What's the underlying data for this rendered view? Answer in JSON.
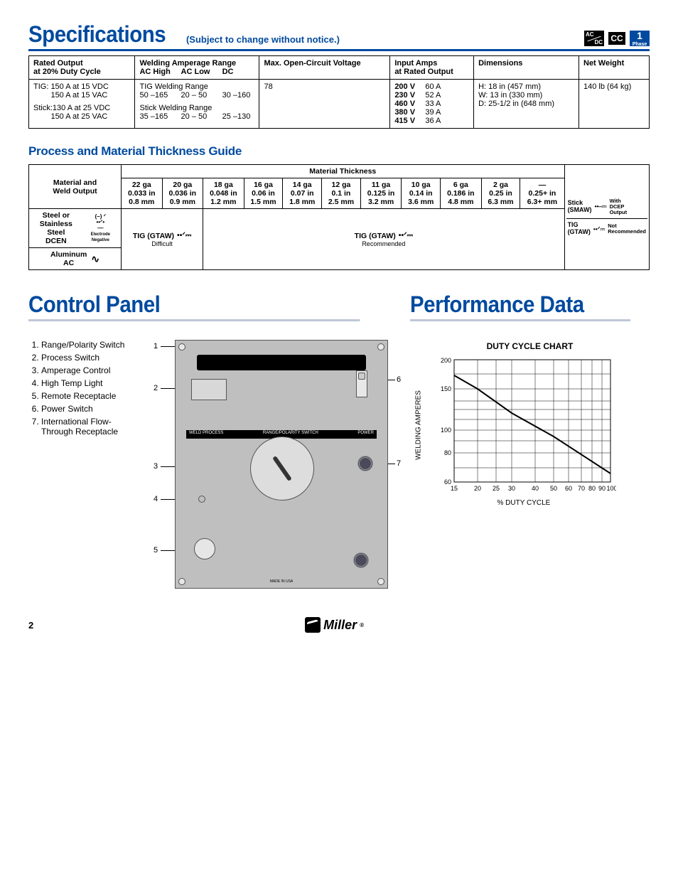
{
  "header": {
    "title": "Specifications",
    "subtitle": "(Subject to change without notice.)",
    "badges": {
      "acdc": "AC/DC",
      "cc": "CC",
      "phase_num": "1",
      "phase_word": "Phase"
    }
  },
  "specs": {
    "cols": {
      "rated_output": "Rated Output\nat 20% Duty Cycle",
      "welding_range": "Welding Amperage Range",
      "welding_sub": {
        "ac_high": "AC High",
        "ac_low": "AC Low",
        "dc": "DC"
      },
      "max_ocv": "Max. Open-Circuit Voltage",
      "input_amps": "Input Amps\nat Rated Output",
      "dimensions": "Dimensions",
      "net_weight": "Net Weight"
    },
    "rated_output": {
      "tig": "TIG: 150 A at 15 VDC\n        150 A at 15 VAC",
      "stick": "Stick:130 A at 25 VDC\n        150 A at 25 VAC"
    },
    "welding": {
      "tig_label": "TIG Welding Range",
      "tig_vals": {
        "ac_high": "50 –165",
        "ac_low": "20 – 50",
        "dc": "30 –160"
      },
      "stick_label": "Stick Welding Range",
      "stick_vals": {
        "ac_high": "35 –165",
        "ac_low": "20 – 50",
        "dc": "25 –130"
      }
    },
    "max_ocv": "78",
    "input_amps": [
      {
        "v": "200 V",
        "a": "60 A"
      },
      {
        "v": "230 V",
        "a": "52 A"
      },
      {
        "v": "460 V",
        "a": "33 A"
      },
      {
        "v": "380 V",
        "a": "39 A"
      },
      {
        "v": "415 V",
        "a": "36 A"
      }
    ],
    "dimensions": {
      "h": "H: 18 in (457 mm)",
      "w": "W: 13 in (330 mm)",
      "d": "D: 25-1/2 in (648 mm)"
    },
    "net_weight": "140 lb (64 kg)"
  },
  "guide": {
    "title": "Process and Material Thickness Guide",
    "header_top": "Material Thickness",
    "row_head": "Material and\nWeld Output",
    "cols": [
      {
        "ga": "22 ga",
        "in": "0.033 in",
        "mm": "0.8 mm"
      },
      {
        "ga": "20 ga",
        "in": "0.036 in",
        "mm": "0.9 mm"
      },
      {
        "ga": "18 ga",
        "in": "0.048 in",
        "mm": "1.2 mm"
      },
      {
        "ga": "16 ga",
        "in": "0.06 in",
        "mm": "1.5 mm"
      },
      {
        "ga": "14 ga",
        "in": "0.07 in",
        "mm": "1.8 mm"
      },
      {
        "ga": "12 ga",
        "in": "0.1 in",
        "mm": "2.5 mm"
      },
      {
        "ga": "11 ga",
        "in": "0.125 in",
        "mm": "3.2 mm"
      },
      {
        "ga": "10 ga",
        "in": "0.14 in",
        "mm": "3.6 mm"
      },
      {
        "ga": "6 ga",
        "in": "0.186 in",
        "mm": "4.8 mm"
      },
      {
        "ga": "2 ga",
        "in": "0.25 in",
        "mm": "6.3 mm"
      },
      {
        "ga": "—",
        "in": "0.25+ in",
        "mm": "6.3+ mm"
      }
    ],
    "rows": {
      "steel": {
        "label": "Steel or\nStainless Steel\nDCEN",
        "note": "(–)",
        "en": "Electrode Negative"
      },
      "aluminum": {
        "label": "Aluminum\nAC"
      }
    },
    "bands": {
      "tig_left": "TIG (GTAW)",
      "difficult": "Difficult",
      "tig_right": "TIG (GTAW)",
      "recommended": "Recommended"
    },
    "legend": {
      "stick": {
        "name": "Stick\n(SMAW)",
        "note": "With\nDCEP\nOutput"
      },
      "tig": {
        "name": "TIG\n(GTAW)",
        "note": "Not\nRecommended"
      }
    }
  },
  "control_panel": {
    "title": "Control Panel",
    "items": [
      "Range/Polarity Switch",
      "Process Switch",
      "Amperage Control",
      "High Temp Light",
      "Remote Receptacle",
      "Power Switch",
      "International Flow-Through Receptacle"
    ]
  },
  "performance": {
    "title": "Performance Data",
    "chart_title": "DUTY CYCLE CHART",
    "y_label": "WELDING AMPERES",
    "x_label": "% DUTY CYCLE"
  },
  "chart_data": {
    "type": "line",
    "title": "DUTY CYCLE CHART",
    "xlabel": "% DUTY CYCLE",
    "ylabel": "WELDING AMPERES",
    "x_scale": "log",
    "y_scale": "log",
    "xlim": [
      15,
      100
    ],
    "ylim": [
      60,
      200
    ],
    "x_ticks": [
      15,
      20,
      25,
      30,
      40,
      50,
      60,
      70,
      80,
      90,
      100
    ],
    "y_ticks": [
      60,
      80,
      100,
      150,
      200
    ],
    "series": [
      {
        "name": "curve",
        "x": [
          15,
          20,
          30,
          50,
          100
        ],
        "y": [
          175,
          150,
          120,
          92,
          66
        ]
      }
    ]
  },
  "footer": {
    "page": "2",
    "brand": "Miller"
  }
}
